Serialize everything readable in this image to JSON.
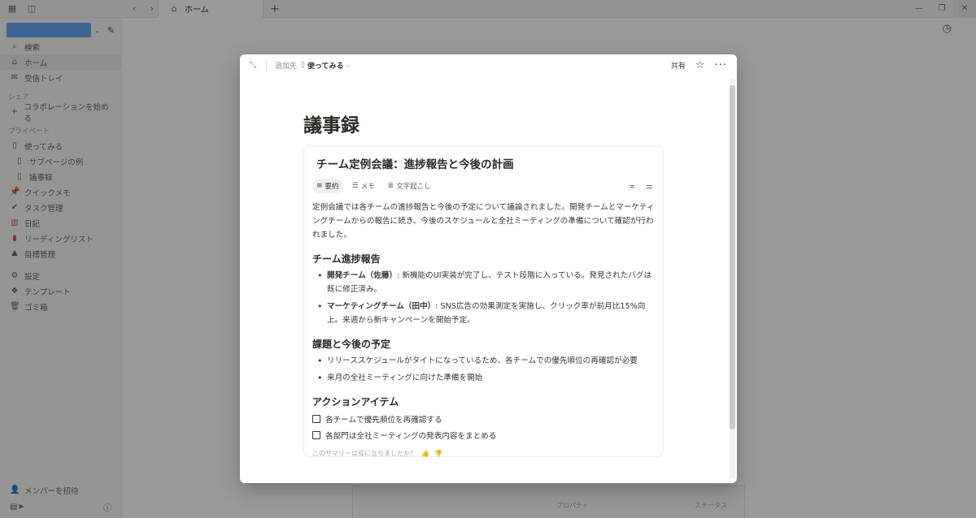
{
  "window": {
    "tab_title": "ホーム"
  },
  "sidebar": {
    "top_items": [
      {
        "icon": "search-icon",
        "label": "検索"
      },
      {
        "icon": "home-icon",
        "label": "ホーム"
      },
      {
        "icon": "inbox-icon",
        "label": "受信トレイ"
      }
    ],
    "share_section": "シェア",
    "share_items": [
      {
        "icon": "plus-icon",
        "label": "コラボレーションを始める"
      }
    ],
    "private_section": "プライベート",
    "private_items": [
      {
        "icon": "page-icon",
        "label": "使ってみる"
      },
      {
        "icon": "page-icon",
        "label": "サブページの例"
      },
      {
        "icon": "page-icon",
        "label": "議事録"
      },
      {
        "icon": "pin-icon",
        "label": "クイックメモ"
      },
      {
        "icon": "check-icon",
        "label": "タスク管理"
      },
      {
        "icon": "calendar-icon",
        "label": "日記"
      },
      {
        "icon": "book-icon",
        "label": "リーディングリスト"
      },
      {
        "icon": "mountain-icon",
        "label": "目標管理"
      }
    ],
    "bottom_items": [
      {
        "icon": "gear-icon",
        "label": "設定"
      },
      {
        "icon": "template-icon",
        "label": "テンプレート"
      },
      {
        "icon": "trash-icon",
        "label": "ゴミ箱"
      }
    ],
    "invite_label": "メンバーを招待"
  },
  "background": {
    "prop_left": "プロパティ",
    "prop_right": "ステータス"
  },
  "modal": {
    "add_to_label": "追加先",
    "page_name": "使ってみる",
    "share_label": "共有",
    "page_title": "議事録",
    "ai_block": {
      "title": "チーム定例会議：進捗報告と今後の計画",
      "tabs": [
        {
          "icon": "summary-icon",
          "label": "要約",
          "active": true
        },
        {
          "icon": "notes-icon",
          "label": "メモ",
          "active": false
        },
        {
          "icon": "transcript-icon",
          "label": "文字起こし",
          "active": false
        }
      ],
      "summary": "定例会議では各チームの進捗報告と今後の予定について議論されました。開発チームとマーケティングチームからの報告に続き、今後のスケジュールと全社ミーティングの準備について確認が行われました。",
      "section1_heading": "チーム進捗報告",
      "section1_items": [
        {
          "bold": "開発チーム（佐藤）",
          "text": ": 新機能のUI実装が完了し、テスト段階に入っている。発見されたバグは既に修正済み。"
        },
        {
          "bold": "マーケティングチーム（田中）",
          "text": ": SNS広告の効果測定を実施し、クリック率が前月比15%向上。来週から新キャンペーンを開始予定。"
        }
      ],
      "section2_heading": "課題と今後の予定",
      "section2_items": [
        "リリーススケジュールがタイトになっているため、各チームでの優先順位の再確認が必要",
        "来月の全社ミーティングに向けた準備を開始"
      ],
      "section3_heading": "アクションアイテム",
      "todos": [
        "各チームで優先順位を再確認する",
        "各部門は全社ミーティングの発表内容をまとめる"
      ],
      "feedback": "このサマリーは役に立ちましたか？"
    }
  }
}
